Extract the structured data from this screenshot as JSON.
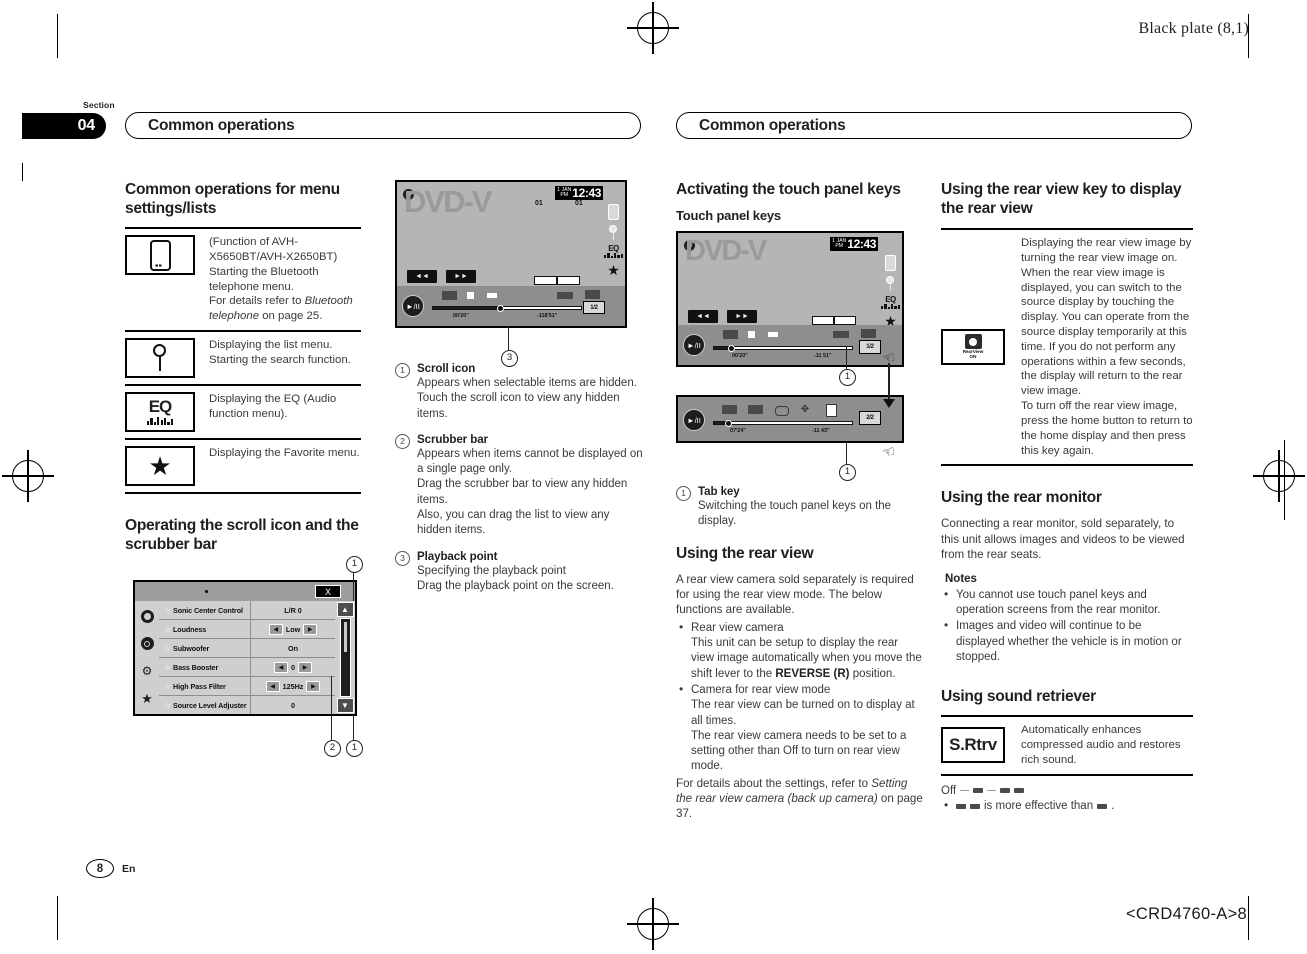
{
  "page": {
    "black_plate": "Black plate (8,1)",
    "doc_code": "<CRD4760-A>8",
    "section_word": "Section",
    "section_number": "04",
    "running_head_left": "Common operations",
    "running_head_right": "Common operations",
    "page_number": "8",
    "language": "En"
  },
  "col1": {
    "heading": "Common operations for menu settings/lists",
    "rows": [
      {
        "icon": "phone-icon",
        "lines": [
          "(Function of AVH-X5650BT/AVH-X2650BT)",
          "Starting the Bluetooth telephone menu.",
          "For details refer to Bluetooth telephone on page 25."
        ],
        "italic_part": "Bluetooth telephone"
      },
      {
        "icon": "pin-icon",
        "lines": [
          "Displaying the list menu.",
          "Starting the search function."
        ]
      },
      {
        "icon": "eq-icon",
        "lines": [
          "Displaying the EQ (Audio function menu)."
        ]
      },
      {
        "icon": "star-icon",
        "lines": [
          "Displaying the Favorite menu."
        ]
      }
    ],
    "heading2": "Operating the scroll icon and the scrubber bar",
    "settings_figure": {
      "close_label": "X",
      "rows": [
        {
          "label": "Sonic Center Control",
          "value": "L/R  0",
          "has_arrows": false
        },
        {
          "label": "Loudness",
          "value": "Low",
          "has_arrows": true
        },
        {
          "label": "Subwoofer",
          "value": "On",
          "has_arrows": false
        },
        {
          "label": "Bass Booster",
          "value": "0",
          "has_arrows": true
        },
        {
          "label": "High Pass Filter",
          "value": "125Hz",
          "has_arrows": true
        },
        {
          "label": "Source Level Adjuster",
          "value": "0",
          "has_arrows": false
        }
      ],
      "callouts": [
        "1",
        "2",
        "1"
      ]
    }
  },
  "col2": {
    "dvd_screen": {
      "title": "DVD-V",
      "track_left": "01",
      "track_right": "01",
      "clock_day": "1 JAN",
      "clock_ampm": "PM",
      "clock_time": "12:43",
      "rew_label": "◄◄",
      "ff_label": "►►",
      "play_label": "►/II",
      "time_elapsed": "00'20\"",
      "time_remaining": "-118'51\"",
      "tab_label": "1/2",
      "callout": "3"
    },
    "callouts": [
      {
        "num": "1",
        "title": "Scroll icon",
        "text": "Appears when selectable items are hidden. Touch the scroll icon to view any hidden items."
      },
      {
        "num": "2",
        "title": "Scrubber bar",
        "text": "Appears when items cannot be displayed on a single page only.\nDrag the scrubber bar to view any hidden items.\nAlso, you can drag the list to view any hidden items."
      },
      {
        "num": "3",
        "title": "Playback point",
        "text": "Specifying the playback point\nDrag the playback point on the screen."
      }
    ]
  },
  "col3": {
    "heading": "Activating the touch panel keys",
    "subheading": "Touch panel keys",
    "screen_top": {
      "title": "DVD-V",
      "clock_day": "1 JAN",
      "clock_ampm": "PM",
      "clock_time": "12:43",
      "rew_label": "◄◄",
      "ff_label": "►►",
      "play_label": "►/II",
      "time_elapsed": "00'20\"",
      "time_remaining": "-11 51\"",
      "tab_label": "1/2",
      "callout": "1"
    },
    "screen_bottom": {
      "play_label": "►/II",
      "time_elapsed": "07'24\"",
      "time_remaining": "-11 43\"",
      "tab_label": "2/2",
      "callout": "1"
    },
    "tab_callout": {
      "num": "1",
      "title": "Tab key",
      "text": "Switching the touch panel keys on the display."
    },
    "rearview_heading": "Using the rear view",
    "rearview_intro": "A rear view camera sold separately is required for using the rear view mode. The below functions are available.",
    "rearview_bullets": [
      {
        "label": "Rear view camera",
        "text_before": "This unit can be setup to display the rear view image automatically when you move the shift lever to the ",
        "bold": "REVERSE (R)",
        "text_after": " position."
      },
      {
        "label": "Camera for rear view mode",
        "text_before": "The rear view can be turned on to display at all times.\nThe rear view camera needs to be set to a setting other than Off to turn on rear view mode.",
        "bold": "",
        "text_after": ""
      }
    ],
    "rearview_footer_plain": "For details about the settings, refer to ",
    "rearview_footer_italic": "Setting the rear view camera (back up camera)",
    "rearview_footer_end": " on page 37."
  },
  "col4": {
    "heading1": "Using the rear view key to display the rear view",
    "rearview_key": {
      "icon_label_line1": "RearView",
      "icon_label_line2": "ON",
      "text": "Displaying the rear view image by turning the rear view image on. When the rear view image is displayed, you can switch to the source display by touching the display. You can operate from the source display temporarily at this time. If you do not perform any operations within a few seconds, the display will return to the rear view image.\nTo turn off the rear view image, press the home button to return to the home display and then press this key again."
    },
    "heading2": "Using the rear monitor",
    "monitor_text": "Connecting a rear monitor, sold separately, to this unit allows images and videos to be viewed from the rear seats.",
    "notes_label": "Notes",
    "notes": [
      "You cannot use touch panel keys and operation screens from the rear monitor.",
      "Images and video will continue to be displayed whether the vehicle is in motion or stopped."
    ],
    "heading3": "Using sound retriever",
    "srtrv": {
      "key_label": "S.Rtrv",
      "text": "Automatically enhances compressed audio and restores rich sound."
    },
    "off_label": "Off",
    "effective_note": "is more effective than"
  }
}
